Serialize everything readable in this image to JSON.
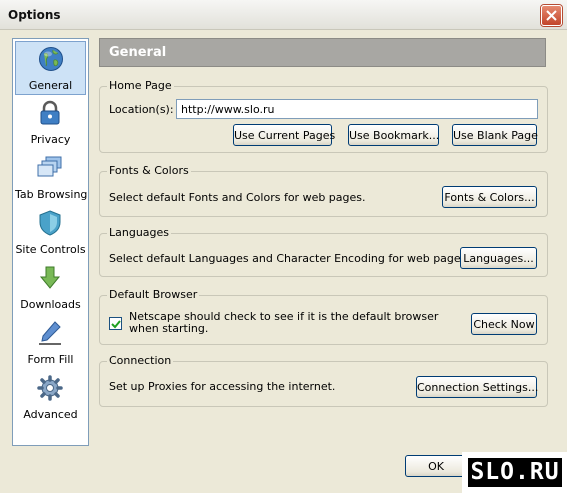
{
  "window": {
    "title": "Options",
    "close_icon": "close-icon"
  },
  "sidebar": {
    "items": [
      {
        "label": "General",
        "icon": "globe-icon",
        "selected": true
      },
      {
        "label": "Privacy",
        "icon": "lock-icon",
        "selected": false
      },
      {
        "label": "Tab Browsing",
        "icon": "tabs-icon",
        "selected": false
      },
      {
        "label": "Site Controls",
        "icon": "shield-icon",
        "selected": false
      },
      {
        "label": "Downloads",
        "icon": "download-arrow-icon",
        "selected": false
      },
      {
        "label": "Form Fill",
        "icon": "pen-icon",
        "selected": false
      },
      {
        "label": "Advanced",
        "icon": "gear-icon",
        "selected": false
      }
    ]
  },
  "header": {
    "title": "General"
  },
  "home_page": {
    "title": "Home Page",
    "location_label": "Location(s):",
    "location_value": "http://www.slo.ru",
    "use_current_label": "Use Current Pages",
    "use_bookmark_label": "Use Bookmark...",
    "use_blank_label": "Use Blank Page"
  },
  "fonts_colors": {
    "title": "Fonts & Colors",
    "description": "Select default Fonts and Colors for web pages.",
    "button_label": "Fonts & Colors..."
  },
  "languages": {
    "title": "Languages",
    "description": "Select default Languages and Character Encoding for web pages.",
    "button_label": "Languages..."
  },
  "default_browser": {
    "title": "Default Browser",
    "check_label": "Netscape should check to see if it is the default browser when starting.",
    "checked": true,
    "button_label": "Check Now"
  },
  "connection": {
    "title": "Connection",
    "description": "Set up Proxies for accessing the internet.",
    "button_label": "Connection Settings..."
  },
  "footer": {
    "ok_label": "OK"
  },
  "watermark": {
    "text": "SLO.RU"
  },
  "colors": {
    "header_bg": "#a8a7a3",
    "dialog_bg": "#ece9d8",
    "selection": "#cde2f6",
    "button_border": "#003c74"
  }
}
